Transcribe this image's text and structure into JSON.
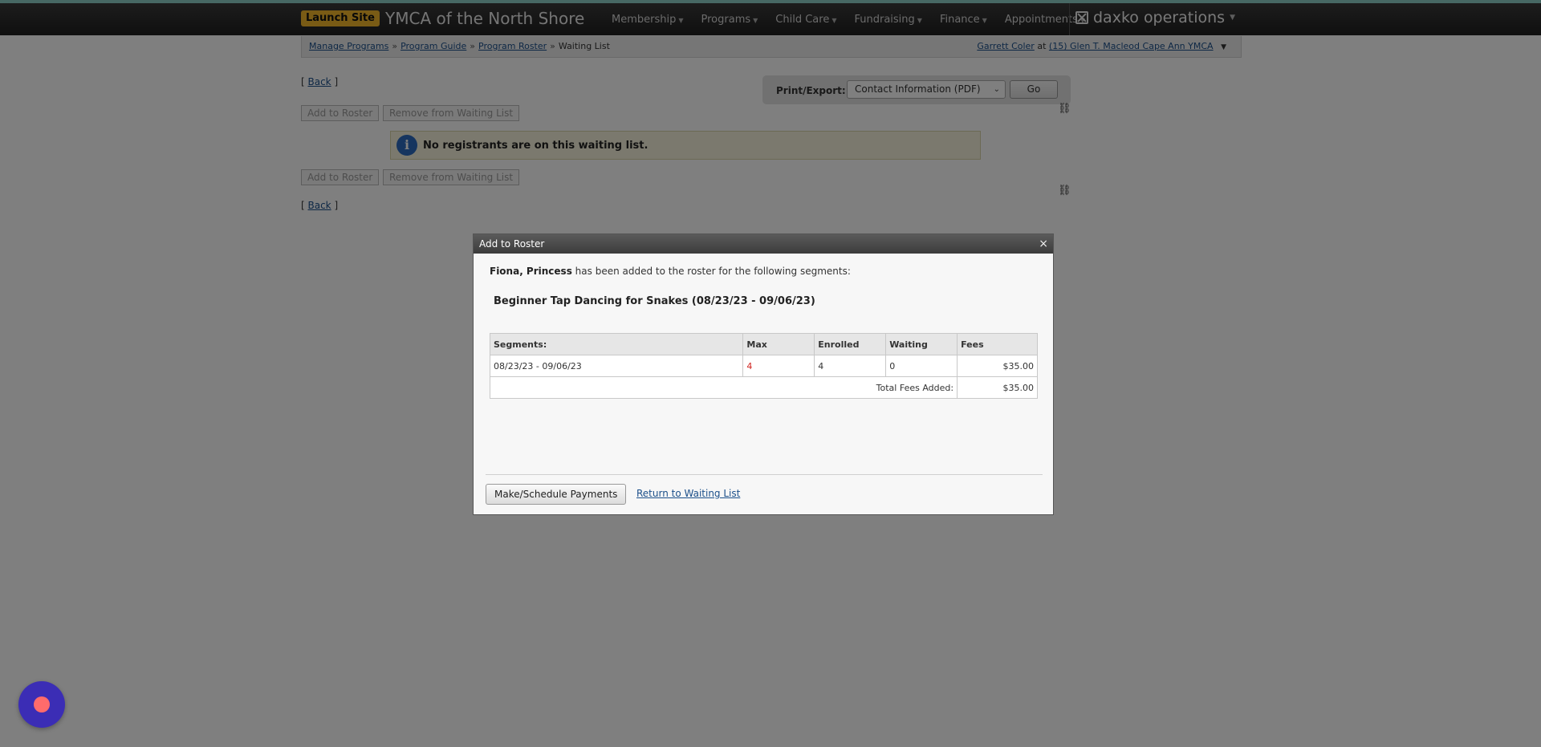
{
  "topnav": {
    "launch_label": "Launch Site",
    "org_name": "YMCA of the North Shore",
    "menu": [
      {
        "label": "Membership"
      },
      {
        "label": "Programs"
      },
      {
        "label": "Child Care"
      },
      {
        "label": "Fundraising"
      },
      {
        "label": "Finance"
      },
      {
        "label": "Appointments"
      }
    ],
    "brand": "daxko operations"
  },
  "breadcrumb": {
    "items": [
      "Manage Programs",
      "Program Guide",
      "Program Roster"
    ],
    "current": "Waiting List",
    "separator": "»"
  },
  "user": {
    "name": "Garrett Coler",
    "at": "at",
    "location": "(15) Glen T. Macleod Cape Ann YMCA"
  },
  "page": {
    "back_label": "Back",
    "add_to_roster": "Add to Roster",
    "remove_from_waiting": "Remove from Waiting List",
    "print_label": "Print/Export:",
    "print_selected": "Contact Information (PDF)",
    "go_label": "Go",
    "info_message": "No registrants are on this waiting list."
  },
  "modal": {
    "title": "Add to Roster",
    "close": "×",
    "registrant": "Fiona, Princess",
    "message": "has been added to the roster for the following segments:",
    "program": "Beginner Tap Dancing for Snakes (08/23/23 - 09/06/23)",
    "table": {
      "headers": [
        "Segments:",
        "Max",
        "Enrolled",
        "Waiting",
        "Fees"
      ],
      "rows": [
        {
          "segment": "08/23/23 - 09/06/23",
          "max": "4",
          "enrolled": "4",
          "waiting": "0",
          "fees": "$35.00"
        }
      ],
      "total_label": "Total Fees Added:",
      "total_value": "$35.00"
    },
    "pay_button": "Make/Schedule Payments",
    "return_link": "Return to Waiting List"
  },
  "colors": {
    "accent_launch": "#f3b62a",
    "link": "#1b4f8a",
    "max_reached": "#d0211c",
    "chat_bubble": "#3b2db5"
  }
}
